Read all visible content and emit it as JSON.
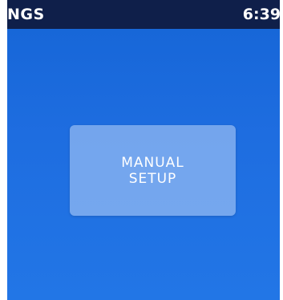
{
  "status_bar": {
    "title": "NGS",
    "time": "6:39/"
  },
  "main": {
    "button": {
      "line1": "MANUAL",
      "line2": "SETUP"
    }
  },
  "colors": {
    "status_bar_bg": "#0f1f4a",
    "screen_bg": "#1e6de0",
    "button_bg": "#9fc0ef",
    "text": "#ffffff"
  }
}
